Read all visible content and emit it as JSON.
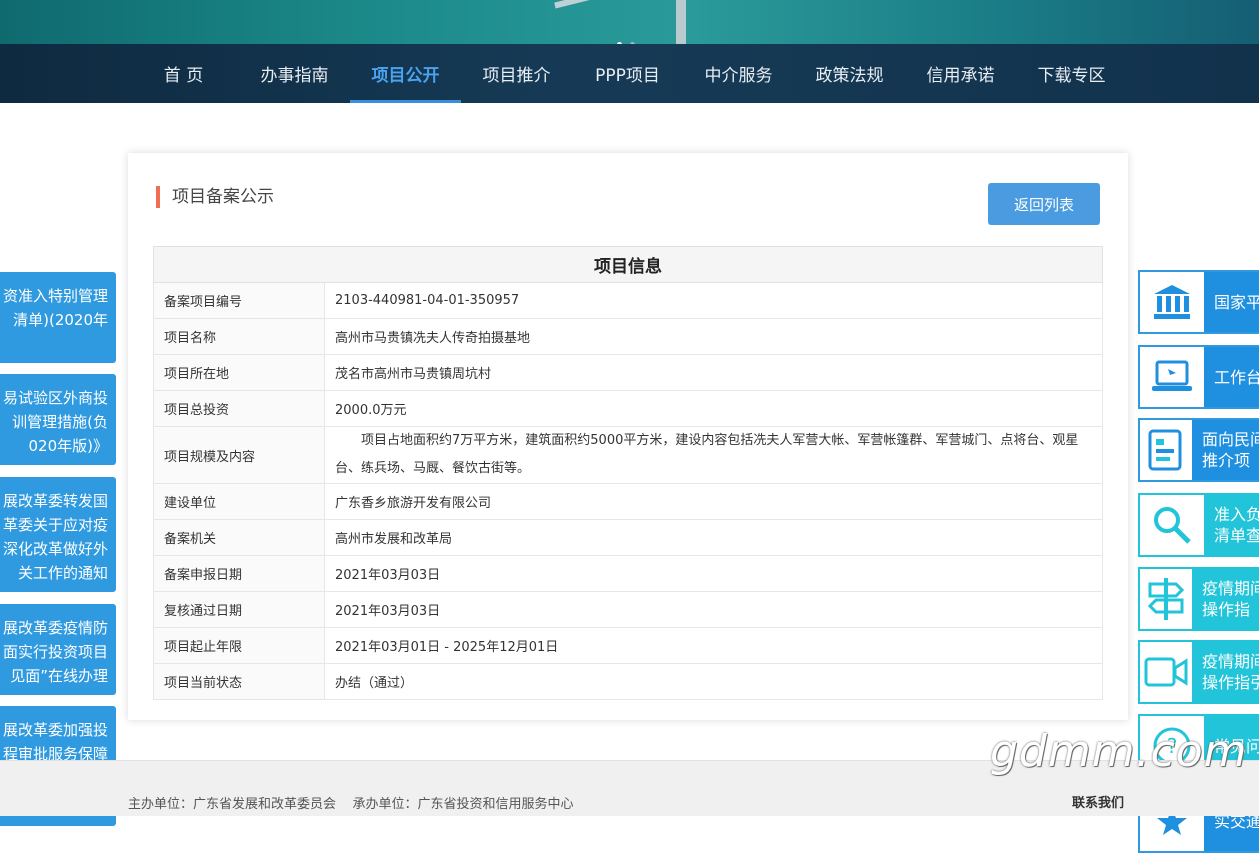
{
  "nav": {
    "items": [
      "首 页",
      "办事指南",
      "项目公开",
      "项目推介",
      "PPP项目",
      "中介服务",
      "政策法规",
      "信用承诺",
      "下载专区"
    ],
    "active": "项目公开"
  },
  "card": {
    "title": "项目备案公示",
    "back_button": "返回列表",
    "table_title": "项目信息",
    "rows": [
      {
        "label": "备案项目编号",
        "value": "2103-440981-04-01-350957"
      },
      {
        "label": "项目名称",
        "value": "高州市马贵镇冼夫人传奇拍摄基地"
      },
      {
        "label": "项目所在地",
        "value": "茂名市高州市马贵镇周坑村"
      },
      {
        "label": "项目总投资",
        "value": "2000.0万元"
      },
      {
        "label": "项目规模及内容",
        "value": "项目占地面积约7万平方米，建筑面积约5000平方米，建设内容包括冼夫人军营大帐、军营帐篷群、军营城门、点将台、观星台、练兵场、马厩、餐饮古街等。"
      },
      {
        "label": "建设单位",
        "value": "广东香乡旅游开发有限公司"
      },
      {
        "label": "备案机关",
        "value": "高州市发展和改革局"
      },
      {
        "label": "备案申报日期",
        "value": "2021年03月03日"
      },
      {
        "label": "复核通过日期",
        "value": "2021年03月03日"
      },
      {
        "label": "项目起止年限",
        "value": "2021年03月01日 - 2025年12月01日"
      },
      {
        "label": "项目当前状态",
        "value": "办结（通过）"
      }
    ]
  },
  "left_news": [
    "资准入特别管理\n清单)(2020年",
    "易试验区外商投\n训管理措施(负\n020年版)》",
    "展改革委转发国\n革委关于应对疫\n深化改革做好外\n关工作的通知",
    "展改革委疫情防\n面实行投资项目\n见面”在线办理",
    "展改革委加强投\n程审批服务保障\n期间项目办理不"
  ],
  "right_panel": [
    {
      "label": "国家平",
      "icon": "bank-icon"
    },
    {
      "label": "工作台",
      "icon": "laptop-icon"
    },
    {
      "label": "面向民间\n推介项",
      "icon": "document-list-icon"
    },
    {
      "label": "准入负\n清单查",
      "icon": "search-icon"
    },
    {
      "label": "疫情期间\n操作指",
      "icon": "signpost-icon"
    },
    {
      "label": "疫情期间\n操作指引",
      "icon": "video-camera-icon"
    },
    {
      "label": "常见问",
      "icon": "question-icon"
    },
    {
      "label": "实交通",
      "icon": "star-icon"
    }
  ],
  "footer": {
    "left": "主办单位：广东省发展和改革委员会    承办单位：广东省投资和信用服务中心",
    "right": "联系我们"
  },
  "watermark": "gdmm.com"
}
